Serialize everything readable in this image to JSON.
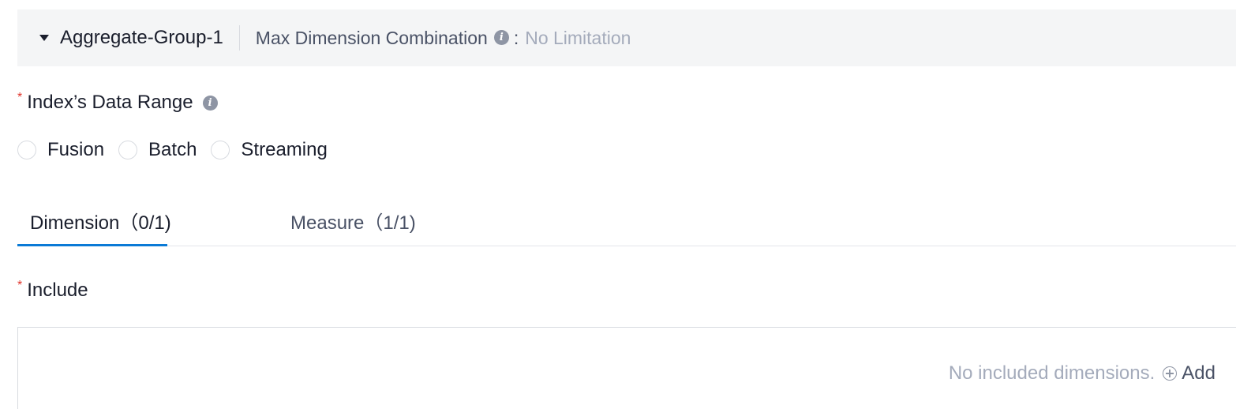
{
  "group_header": {
    "name": "Aggregate-Group-1",
    "max_label": "Max Dimension Combination",
    "separator": ":",
    "max_value": "No Limitation"
  },
  "data_range": {
    "required_mark": "*",
    "label": "Index’s Data Range",
    "options": [
      "Fusion",
      "Batch",
      "Streaming"
    ]
  },
  "tabs": [
    {
      "label": "Dimension（0/1)",
      "active": true
    },
    {
      "label": "Measure（1/1)",
      "active": false
    }
  ],
  "include": {
    "required_mark": "*",
    "label": "Include",
    "empty_text": "No included dimensions.",
    "add_label": "Add"
  },
  "colors": {
    "accent": "#0a7ad6",
    "required": "#e0342b",
    "header_bg": "#f4f5f6"
  }
}
